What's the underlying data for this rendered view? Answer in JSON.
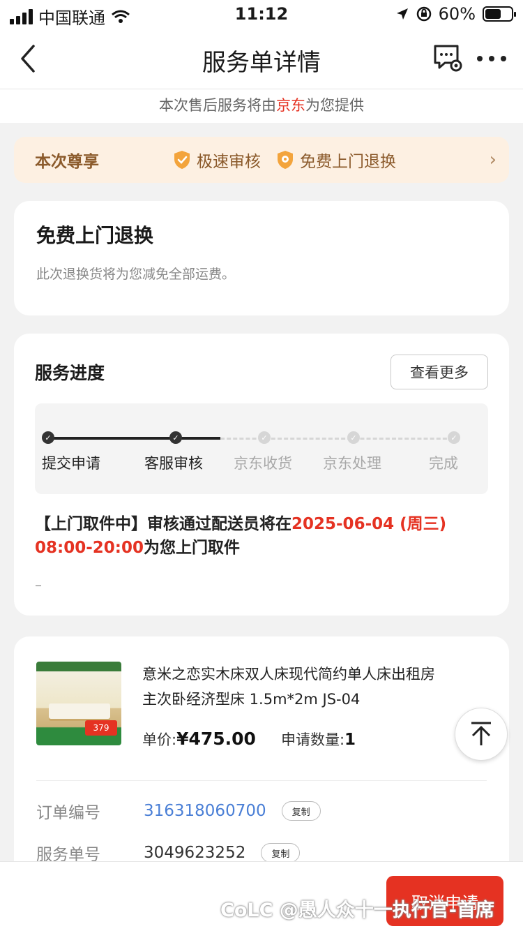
{
  "status_bar": {
    "carrier": "中国联通",
    "time": "11:12",
    "battery": "60%",
    "battery_level": 0.6
  },
  "nav": {
    "title": "服务单详情"
  },
  "provider": {
    "prefix": "本次售后服务将由",
    "brand": "京东",
    "suffix": "为您提供"
  },
  "privilege": {
    "label": "本次尊享",
    "items": [
      "极速审核",
      "免费上门退换"
    ]
  },
  "free_return": {
    "title": "免费上门退换",
    "desc": "此次退换货将为您减免全部运费。"
  },
  "progress": {
    "title": "服务进度",
    "more_label": "查看更多",
    "steps": [
      {
        "label": "提交申请",
        "done": true
      },
      {
        "label": "客服审核",
        "done": true
      },
      {
        "label": "京东收货",
        "done": false
      },
      {
        "label": "京东处理",
        "done": false
      },
      {
        "label": "完成",
        "done": false
      }
    ],
    "notice_prefix": "【上门取件中】审核通过配送员将在",
    "notice_date": "2025-06-04 (周三)",
    "notice_time": "08:00-20:00",
    "notice_suffix": "为您上门取件",
    "extra": "–"
  },
  "product": {
    "name": "意米之恋实木床双人床现代简约单人床出租房主次卧经济型床 1.5m*2m JS-04",
    "price_label": "单价:",
    "price": "¥475.00",
    "qty_label": "申请数量:",
    "qty": "1",
    "thumb_tag": "379"
  },
  "details": {
    "order_label": "订单编号",
    "order_value": "316318060700",
    "service_label": "服务单号",
    "service_value": "3049623252",
    "copy_label": "复制"
  },
  "footer": {
    "cancel_label": "取消申请"
  },
  "watermark": "CoLC @愚人众十一执行官-首席",
  "colors": {
    "accent": "#e53222",
    "link": "#4a7fd6",
    "privilege_bg": "#fdf0e2",
    "privilege_text": "#8b5a2b"
  },
  "icons": [
    "back-icon",
    "chat-settings-icon",
    "more-icon",
    "shield-check-icon",
    "shield-home-icon",
    "chevron-right-icon",
    "back-to-top-icon"
  ]
}
